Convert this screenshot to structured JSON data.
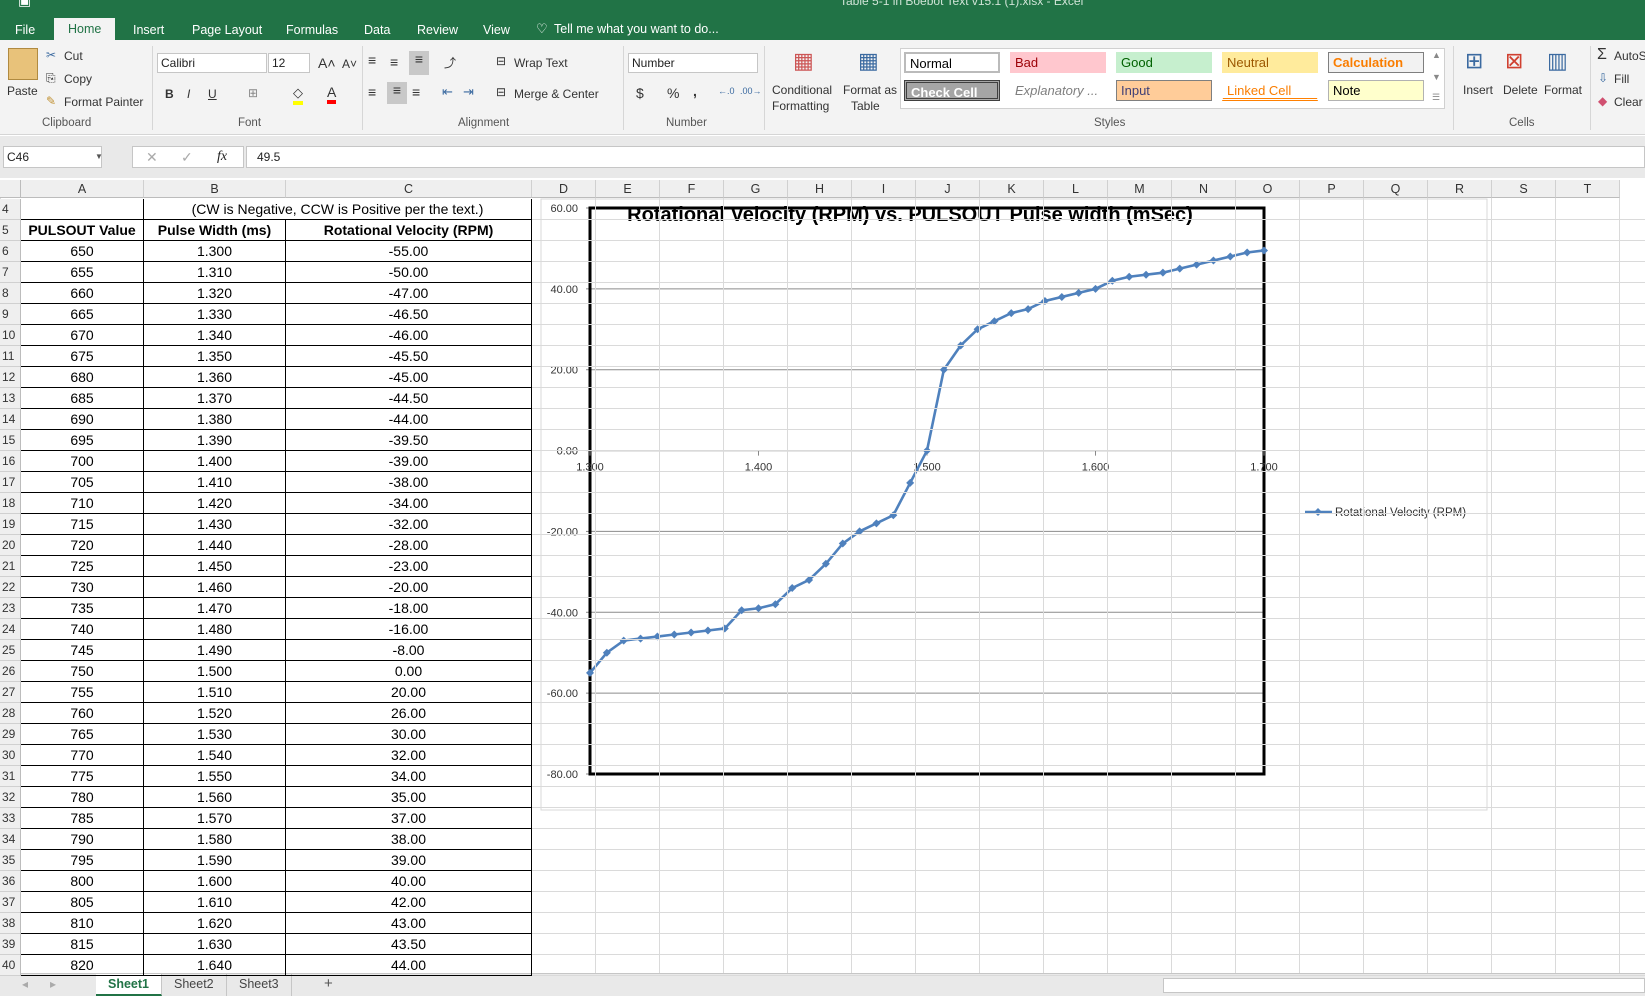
{
  "window": {
    "title": "Table 5-1 in Boebot Text v15.1 (1).xlsx - Excel"
  },
  "ribbon": {
    "tabs": [
      "File",
      "Home",
      "Insert",
      "Page Layout",
      "Formulas",
      "Data",
      "Review",
      "View"
    ],
    "tell_me": "Tell me what you want to do...",
    "clipboard": {
      "paste": "Paste",
      "cut": "Cut",
      "copy": "Copy",
      "format_painter": "Format Painter",
      "label": "Clipboard"
    },
    "font": {
      "name": "Calibri",
      "size": "12",
      "bold": "B",
      "italic": "I",
      "underline": "U",
      "label": "Font",
      "font_color": "#ff0000",
      "fill_color": "#ffff00"
    },
    "alignment": {
      "wrap_text": "Wrap Text",
      "merge_center": "Merge & Center",
      "label": "Alignment"
    },
    "number": {
      "format": "Number",
      "currency": "$",
      "percent": "%",
      "comma": ",",
      "label": "Number"
    },
    "styles": {
      "conditional": "Conditional",
      "conditional2": "Formatting",
      "format_as": "Format as",
      "format_as2": "Table",
      "label": "Styles",
      "gallery": [
        [
          "Normal",
          "Bad",
          "Good",
          "Neutral",
          "Calculation"
        ],
        [
          "Check Cell",
          "Explanatory ...",
          "Input",
          "Linked Cell",
          "Note"
        ]
      ]
    },
    "cells": {
      "insert": "Insert",
      "delete": "Delete",
      "format": "Format",
      "label": "Cells"
    },
    "editing": {
      "autosum": "AutoSum",
      "fill": "Fill",
      "clear": "Clear"
    }
  },
  "formula_bar": {
    "name_box": "C46",
    "value": "49.5",
    "fx": "fx"
  },
  "columns": [
    "A",
    "B",
    "C",
    "D",
    "E",
    "F",
    "G",
    "H",
    "I",
    "J",
    "K",
    "L",
    "M",
    "N",
    "O",
    "P",
    "Q",
    "R",
    "S",
    "T"
  ],
  "sheet": {
    "note": "(CW is Negative, CCW is Positive per the text.)",
    "headers": [
      "PULSOUT Value",
      "Pulse Width (ms)",
      "Rotational Velocity (RPM)"
    ],
    "first_row": 4,
    "rows": [
      [
        "650",
        "1.300",
        "-55.00"
      ],
      [
        "655",
        "1.310",
        "-50.00"
      ],
      [
        "660",
        "1.320",
        "-47.00"
      ],
      [
        "665",
        "1.330",
        "-46.50"
      ],
      [
        "670",
        "1.340",
        "-46.00"
      ],
      [
        "675",
        "1.350",
        "-45.50"
      ],
      [
        "680",
        "1.360",
        "-45.00"
      ],
      [
        "685",
        "1.370",
        "-44.50"
      ],
      [
        "690",
        "1.380",
        "-44.00"
      ],
      [
        "695",
        "1.390",
        "-39.50"
      ],
      [
        "700",
        "1.400",
        "-39.00"
      ],
      [
        "705",
        "1.410",
        "-38.00"
      ],
      [
        "710",
        "1.420",
        "-34.00"
      ],
      [
        "715",
        "1.430",
        "-32.00"
      ],
      [
        "720",
        "1.440",
        "-28.00"
      ],
      [
        "725",
        "1.450",
        "-23.00"
      ],
      [
        "730",
        "1.460",
        "-20.00"
      ],
      [
        "735",
        "1.470",
        "-18.00"
      ],
      [
        "740",
        "1.480",
        "-16.00"
      ],
      [
        "745",
        "1.490",
        "-8.00"
      ],
      [
        "750",
        "1.500",
        "0.00"
      ],
      [
        "755",
        "1.510",
        "20.00"
      ],
      [
        "760",
        "1.520",
        "26.00"
      ],
      [
        "765",
        "1.530",
        "30.00"
      ],
      [
        "770",
        "1.540",
        "32.00"
      ],
      [
        "775",
        "1.550",
        "34.00"
      ],
      [
        "780",
        "1.560",
        "35.00"
      ],
      [
        "785",
        "1.570",
        "37.00"
      ],
      [
        "790",
        "1.580",
        "38.00"
      ],
      [
        "795",
        "1.590",
        "39.00"
      ],
      [
        "800",
        "1.600",
        "40.00"
      ],
      [
        "805",
        "1.610",
        "42.00"
      ],
      [
        "810",
        "1.620",
        "43.00"
      ],
      [
        "815",
        "1.630",
        "43.50"
      ],
      [
        "820",
        "1.640",
        "44.00"
      ]
    ]
  },
  "chart_data": {
    "type": "line",
    "title": "Rotational Velocity (RPM) vs. PULSOUT Pulse width (mSec)",
    "xlim": [
      1.3,
      1.7
    ],
    "ylim": [
      -80,
      60
    ],
    "xticks": [
      "1.300",
      "1.400",
      "1.500",
      "1.600",
      "1.700"
    ],
    "yticks": [
      "60.00",
      "40.00",
      "20.00",
      "0.00",
      "-20.00",
      "-40.00",
      "-60.00",
      "-80.00"
    ],
    "grid": true,
    "legend": "right",
    "color": "#4f81bd",
    "series": [
      {
        "name": "Rotational Velocity (RPM)",
        "x": [
          1.3,
          1.31,
          1.32,
          1.33,
          1.34,
          1.35,
          1.36,
          1.37,
          1.38,
          1.39,
          1.4,
          1.41,
          1.42,
          1.43,
          1.44,
          1.45,
          1.46,
          1.47,
          1.48,
          1.49,
          1.5,
          1.51,
          1.52,
          1.53,
          1.54,
          1.55,
          1.56,
          1.57,
          1.58,
          1.59,
          1.6,
          1.61,
          1.62,
          1.63,
          1.64,
          1.65,
          1.66,
          1.67,
          1.68,
          1.69,
          1.7
        ],
        "y": [
          -55,
          -50,
          -47,
          -46.5,
          -46,
          -45.5,
          -45,
          -44.5,
          -44,
          -39.5,
          -39,
          -38,
          -34,
          -32,
          -28,
          -23,
          -20,
          -18,
          -16,
          -8,
          0,
          20,
          26,
          30,
          32,
          34,
          35,
          37,
          38,
          39,
          40,
          42,
          43,
          43.5,
          44,
          45,
          46,
          47,
          48,
          49,
          49.5
        ]
      }
    ]
  },
  "sheet_tabs": [
    "Sheet1",
    "Sheet2",
    "Sheet3"
  ],
  "add_sheet": "+"
}
